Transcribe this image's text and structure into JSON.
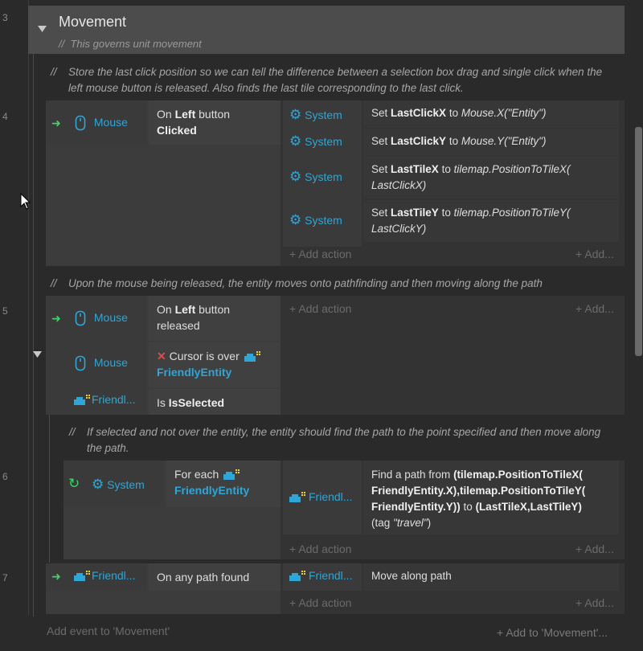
{
  "line_numbers": [
    "3",
    "4",
    "5",
    "6",
    "7"
  ],
  "group": {
    "title": "Movement",
    "comment": "This governs unit movement",
    "comment_marker": "//"
  },
  "comments": {
    "c1": "Store the last click position so we can tell the difference between a selection box drag and single click when the left mouse button is released. Also finds the last tile corresponding to the last click.",
    "c2": "Upon the mouse being released, the entity moves onto pathfinding and then moving along the path",
    "c3": "If selected and not over the entity, the entity should find the path to the point specified and then move along the path."
  },
  "event1": {
    "cond_object": "Mouse",
    "cond_text_pre": "On",
    "cond_text_b1": "Left",
    "cond_text_mid": "button",
    "cond_text_b2": "Clicked",
    "actions": [
      {
        "object": "System",
        "pre": "Set",
        "var": "LastClickX",
        "mid": "to",
        "expr": "Mouse.X(\"Entity\")",
        "expr2": ""
      },
      {
        "object": "System",
        "pre": "Set",
        "var": "LastClickY",
        "mid": "to",
        "expr": "Mouse.Y(\"Entity\")",
        "expr2": ""
      },
      {
        "object": "System",
        "pre": "Set",
        "var": "LastTileX",
        "mid": "to",
        "expr": "tilemap.PositionToTileX(",
        "expr2": "LastClickX)"
      },
      {
        "object": "System",
        "pre": "Set",
        "var": "LastTileY",
        "mid": "to",
        "expr": "tilemap.PositionToTileY(",
        "expr2": "LastClickY)"
      }
    ]
  },
  "event2": {
    "cond1_object": "Mouse",
    "cond1_pre": "On",
    "cond1_b": "Left",
    "cond1_post": "button released",
    "cond2_object": "Mouse",
    "cond2_text": "Cursor is over",
    "cond2_entity": "FriendlyEntity",
    "cond3_object": "Friendl...",
    "cond3_pre": "Is",
    "cond3_b": "IsSelected"
  },
  "event3": {
    "cond_object": "System",
    "cond_text": "For each",
    "cond_entity": "FriendlyEntity",
    "action_object": "Friendl...",
    "action_line1_pre": "Find a path from",
    "action_line1_b": "(tilemap.PositionToTileX(",
    "action_line2_b": "FriendlyEntity.X),tilemap.PositionToTileY(",
    "action_line3_b": "FriendlyEntity.Y))",
    "action_line3_mid": "to",
    "action_line3_b2": "(LastTileX,LastTileY)",
    "action_line4_pre": "(tag",
    "action_line4_i": "\"travel\"",
    "action_line4_post": ")"
  },
  "event4": {
    "cond_object": "Friendl...",
    "cond_text": "On any path found",
    "action_object": "Friendl...",
    "action_text": "Move along path"
  },
  "labels": {
    "add_action": "Add action",
    "add_short": "Add...",
    "add_event": "Add event to 'Movement'",
    "add_to": "Add to 'Movement'..."
  },
  "colors": {
    "accent_blue": "#2fa6d6",
    "trigger_green": "#3fd36a",
    "invert_red": "#e04a4a",
    "group_header": "#4c4c4c",
    "background": "#2a2a2a"
  },
  "icons": [
    "collapse-triangle-icon",
    "mouse-icon",
    "gear-icon",
    "trigger-arrow-icon",
    "invert-x-icon",
    "sprite-entity-icon",
    "loop-icon",
    "plus-icon",
    "mouse-cursor-icon"
  ]
}
